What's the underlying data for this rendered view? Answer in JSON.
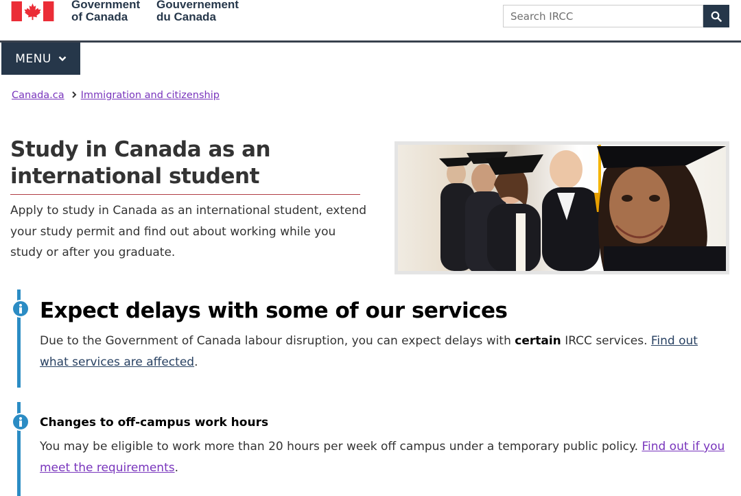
{
  "header": {
    "signature_en": [
      "Government",
      "of Canada"
    ],
    "signature_fr": [
      "Gouvernement",
      "du Canada"
    ],
    "search": {
      "placeholder": "Search IRCC",
      "button_icon": "search-icon"
    }
  },
  "menu": {
    "label": "MENU",
    "icon": "chevron-down-icon"
  },
  "breadcrumb": [
    {
      "label": "Canada.ca"
    },
    {
      "label": "Immigration and citizenship"
    }
  ],
  "page": {
    "title": "Study in Canada as an international student",
    "intro": "Apply to study in Canada as an international student, extend your study permit and find out about working while you study or after you graduate."
  },
  "alerts": [
    {
      "heading": "Expect delays with some of our services",
      "text_before": "Due to the Government of Canada labour disruption, you can expect delays with ",
      "text_bold": "certain",
      "text_after": " IRCC services. ",
      "link": "Find out what services are affected",
      "end": "."
    },
    {
      "heading": "Changes to off-campus work hours",
      "text_before": "You may be eligible to work more than 20 hours per week off campus under a temporary public policy. ",
      "link": "Find out if you meet the requirements",
      "end": "."
    }
  ],
  "colors": {
    "brand_dark": "#26374a",
    "flag_red": "#eb2d37",
    "alert_blue": "#2b8cc4",
    "visited_link": "#7834bc",
    "link": "#284162",
    "title_rule": "#af3c43"
  }
}
